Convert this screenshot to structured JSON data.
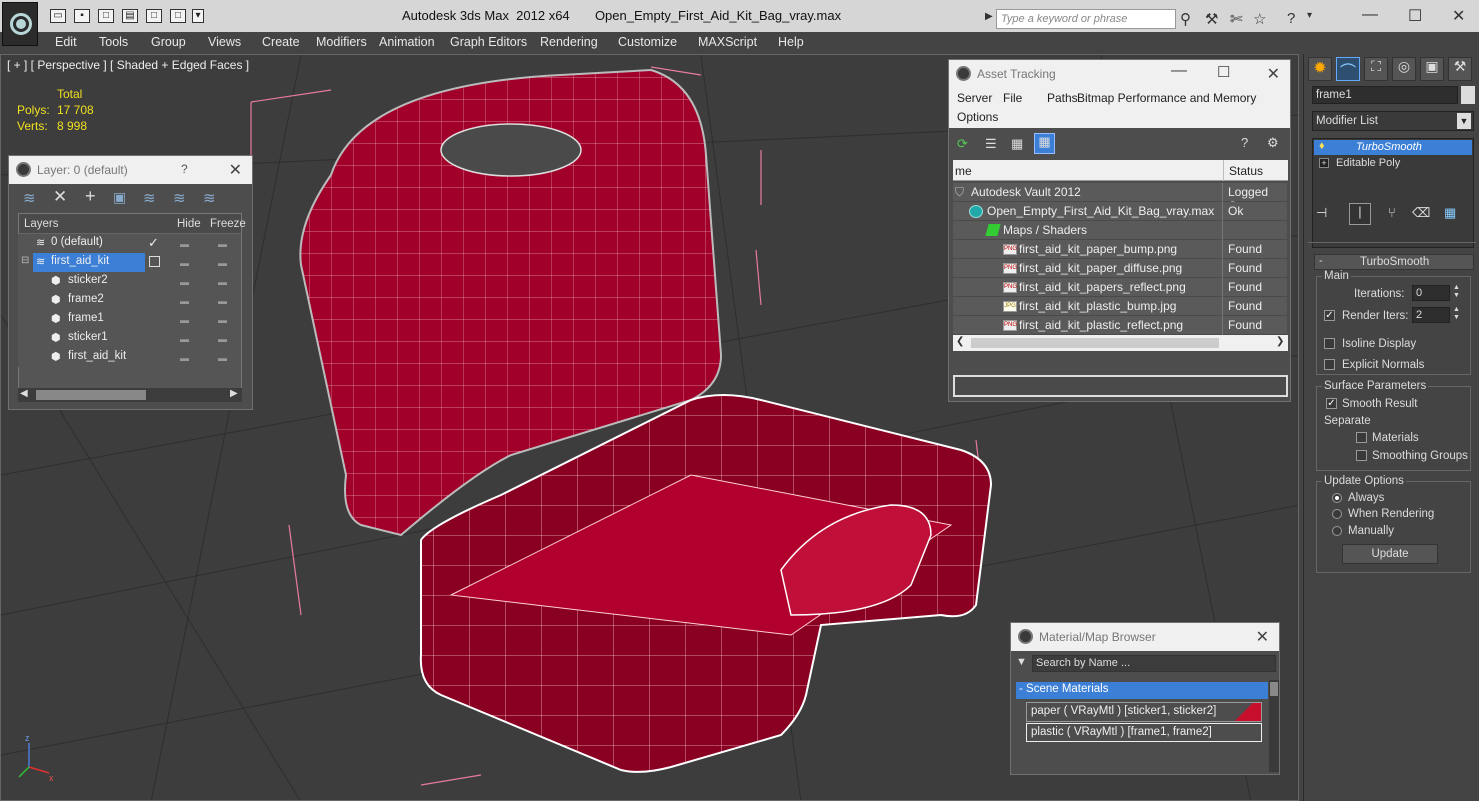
{
  "window": {
    "title": "Autodesk 3ds Max  2012 x64       Open_Empty_First_Aid_Kit_Bag_vray.max",
    "search_placeholder": "Type a keyword or phrase"
  },
  "menu": [
    "Edit",
    "Tools",
    "Group",
    "Views",
    "Create",
    "Modifiers",
    "Animation",
    "Graph Editors",
    "Rendering",
    "Customize",
    "MAXScript",
    "Help"
  ],
  "viewport": {
    "label": "[ + ] [ Perspective ] [ Shaded + Edged Faces ]",
    "stats_header": "Total",
    "polys_label": "Polys:",
    "polys_value": "17 708",
    "verts_label": "Verts:",
    "verts_value": "8 998"
  },
  "layer_panel": {
    "title": "Layer: 0 (default)",
    "help": "?",
    "col_layers": "Layers",
    "col_hide": "Hide",
    "col_freeze": "Freeze",
    "rows": [
      {
        "name": "0 (default)"
      },
      {
        "name": "first_aid_kit"
      },
      {
        "name": "sticker2"
      },
      {
        "name": "frame2"
      },
      {
        "name": "frame1"
      },
      {
        "name": "sticker1"
      },
      {
        "name": "first_aid_kit"
      }
    ]
  },
  "asset_tracking": {
    "title": "Asset Tracking",
    "menu": [
      "Server",
      "File",
      "Paths",
      "Bitmap Performance and Memory",
      "Options"
    ],
    "col_name": "me",
    "col_status": "Status",
    "rows": [
      {
        "name": "Autodesk Vault 2012",
        "status": "Logged Ou"
      },
      {
        "name": "Open_Empty_First_Aid_Kit_Bag_vray.max",
        "status": "Ok"
      },
      {
        "name": "Maps / Shaders",
        "status": ""
      },
      {
        "name": "first_aid_kit_paper_bump.png",
        "status": "Found"
      },
      {
        "name": "first_aid_kit_paper_diffuse.png",
        "status": "Found"
      },
      {
        "name": "first_aid_kit_papers_reflect.png",
        "status": "Found"
      },
      {
        "name": "first_aid_kit_plastic_bump.jpg",
        "status": "Found"
      },
      {
        "name": "first_aid_kit_plastic_reflect.png",
        "status": "Found"
      }
    ]
  },
  "material_browser": {
    "title": "Material/Map Browser",
    "search_placeholder": "Search by Name ...",
    "section": "- Scene Materials",
    "items": [
      {
        "label": "paper  ( VRayMtl )  [sticker1, sticker2]"
      },
      {
        "label": "plastic  ( VRayMtl )  [frame1, frame2]"
      }
    ]
  },
  "command_panel": {
    "object_name": "frame1",
    "modifier_list": "Modifier List",
    "stack": [
      "TurboSmooth",
      "Editable Poly"
    ],
    "rollout_title": "TurboSmooth",
    "main_label": "Main",
    "iterations_label": "Iterations:",
    "iterations_value": "0",
    "render_iters_label": "Render Iters:",
    "render_iters_value": "2",
    "isoline": "Isoline Display",
    "explicit_normals": "Explicit Normals",
    "surface_params": "Surface Parameters",
    "smooth_result": "Smooth Result",
    "separate": "Separate",
    "materials": "Materials",
    "smoothing_groups": "Smoothing Groups",
    "update_options": "Update Options",
    "always": "Always",
    "when_rendering": "When Rendering",
    "manually": "Manually",
    "update_button": "Update"
  },
  "colors": {
    "accent_select": "#3c7fd6",
    "model_red": "#a8002a",
    "bounding_box": "#e67aa0",
    "stats_yellow": "#f0e020"
  }
}
